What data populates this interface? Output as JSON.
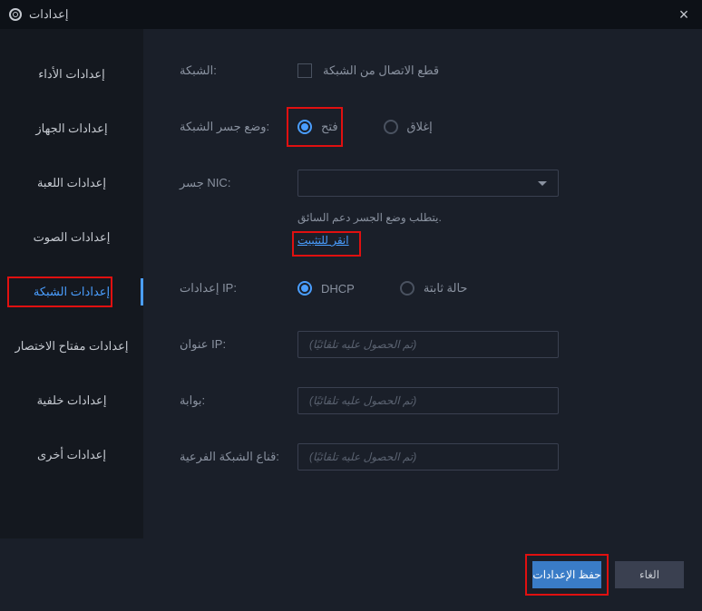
{
  "header": {
    "title": "إعدادات"
  },
  "sidebar": {
    "items": [
      {
        "label": "إعدادات الأداء"
      },
      {
        "label": "إعدادات الجهاز"
      },
      {
        "label": "إعدادات اللعبة"
      },
      {
        "label": "إعدادات الصوت"
      },
      {
        "label": "إعدادات الشبكة"
      },
      {
        "label": "إعدادات مفتاح الاختصار"
      },
      {
        "label": "إعدادات خلفية"
      },
      {
        "label": "إعدادات أخرى"
      }
    ],
    "activeIndex": 4
  },
  "form": {
    "network": {
      "label": "الشبكة:",
      "checkbox_label": "قطع الاتصال من الشبكة"
    },
    "bridge_mode": {
      "label": "وضع جسر الشبكة:",
      "open": "فتح",
      "close": "إغلاق"
    },
    "nic": {
      "label": "جسر NIC:"
    },
    "driver_info": "يتطلب وضع الجسر دعم السائق.",
    "install_link": "انقر للتثبيت",
    "ip_settings": {
      "label": "إعدادات IP:",
      "dhcp": "DHCP",
      "static": "حالة ثابتة"
    },
    "ip_address": {
      "label": "عنوان IP:",
      "placeholder": "(تم الحصول عليه تلقائيًا)"
    },
    "gateway": {
      "label": "بوابة:",
      "placeholder": "(تم الحصول عليه تلقائيًا)"
    },
    "subnet": {
      "label": "قناع الشبكة الفرعية:",
      "placeholder": "(تم الحصول عليه تلقائيًا)"
    }
  },
  "footer": {
    "save": "حفظ الإعدادات",
    "cancel": "الغاء"
  }
}
